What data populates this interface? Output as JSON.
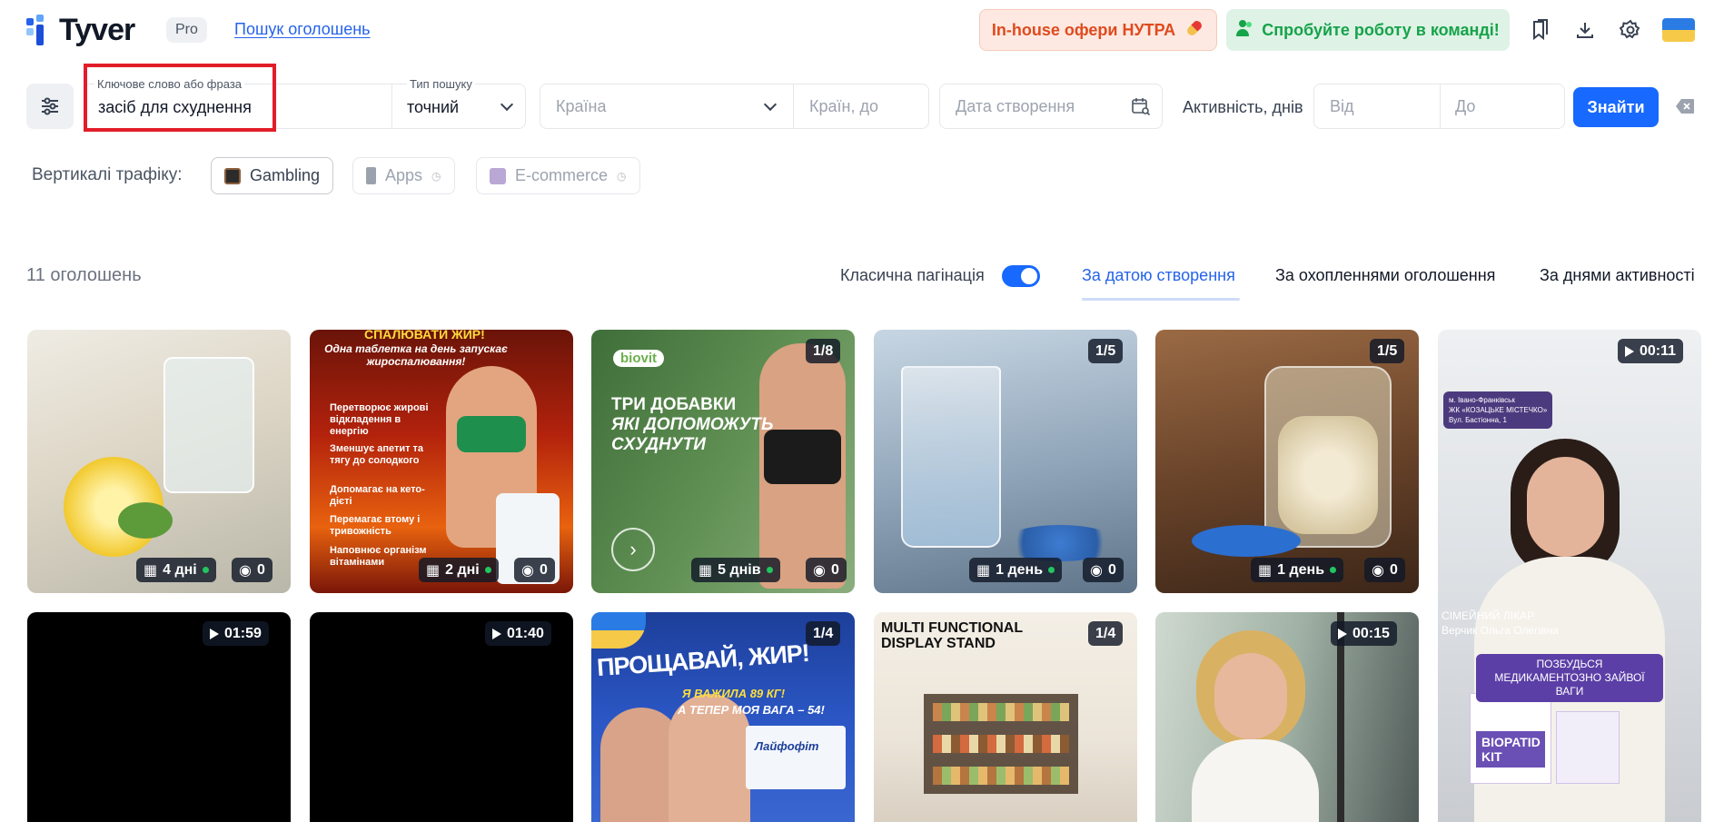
{
  "header": {
    "logo_text": "Tyver",
    "plan_badge": "Pro",
    "nav_link": "Пошук оголошень",
    "hutra_button": "In-house офери НУТРА",
    "team_button": "Спробуйте роботу в команді!",
    "icons": [
      "bookmark-icon",
      "download-icon",
      "gear-icon",
      "flag-ua-icon"
    ]
  },
  "filters": {
    "keyword_label": "Ключове слово або фраза",
    "keyword_value": "засіб для схуднення",
    "search_type_label": "Тип пошуку",
    "search_type_value": "точний",
    "country_placeholder": "Країна",
    "exclude_countries_placeholder": "Країн, до",
    "creation_date_placeholder": "Дата створення",
    "activity_label": "Активність, днів",
    "from_placeholder": "Від",
    "to_placeholder": "До",
    "search_button": "Знайти"
  },
  "verticals": {
    "label": "Вертикалі трафіку:",
    "items": [
      {
        "label": "Gambling",
        "state": "active"
      },
      {
        "label": "Apps",
        "state": "disabled"
      },
      {
        "label": "E-commerce",
        "state": "disabled"
      }
    ]
  },
  "results": {
    "count": "11 оголошень",
    "pagination_label": "Класична пагінація",
    "pagination_on": true,
    "sort_tabs": [
      "За датою створення",
      "За охопленнями оголошення",
      "За днями активності"
    ],
    "active_sort": 0
  },
  "cards": [
    {
      "days": "4 дні",
      "views": "0"
    },
    {
      "days": "2 дні",
      "views": "0",
      "headline": "СПАЛЮВАТИ ЖИР!",
      "subheadline": "Одна таблетка на день запускає жироспалювання!",
      "bullets": [
        "Перетворює жирові відкладення в енергію",
        "Зменшує апетит та тягу до солодкого",
        "Допомагає на кето-дієті",
        "Перемагає втому і тривожність",
        "Наповнює організм вітамінами"
      ]
    },
    {
      "counter": "1/8",
      "days": "5 днів",
      "views": "0",
      "brand": "biovit",
      "headline_1": "ТРИ ДОБАВКИ",
      "headline_2": "ЯКІ ДОПОМОЖУТЬ СХУДНУТИ"
    },
    {
      "counter": "1/5",
      "days": "1 день",
      "views": "0"
    },
    {
      "counter": "1/5",
      "days": "1 день",
      "views": "0"
    },
    {
      "duration": "00:11",
      "location_1": "м. Івано-Франківськ",
      "location_2": "ЖК «КОЗАЦЬКЕ МІСТЕЧКО»",
      "location_3": "Вул. Бастіонна, 1",
      "doctor_1": "СІМЕЙНИЙ ЛІКАР",
      "doctor_2": "Верчик Ольга Олегівна",
      "cta": "ПОЗБУДЬСЯ МЕДИКАМЕНТОЗНО ЗАЙВОЇ ВАГИ",
      "product": "BIOPATID KIT"
    },
    {
      "duration": "01:59"
    },
    {
      "duration": "01:40"
    },
    {
      "counter": "1/4",
      "headline": "ПРОЩАВАЙ, ЖИР!",
      "sub_1": "Я ВАЖИЛА 89 КГ!",
      "sub_2": "А ТЕПЕР МОЯ ВАГА – 54!",
      "product": "Лайфофіт"
    },
    {
      "counter": "1/4",
      "headline_1": "MULTI FUNCTIONAL",
      "headline_2": "DISPLAY STAND"
    },
    {
      "duration": "00:15"
    }
  ]
}
